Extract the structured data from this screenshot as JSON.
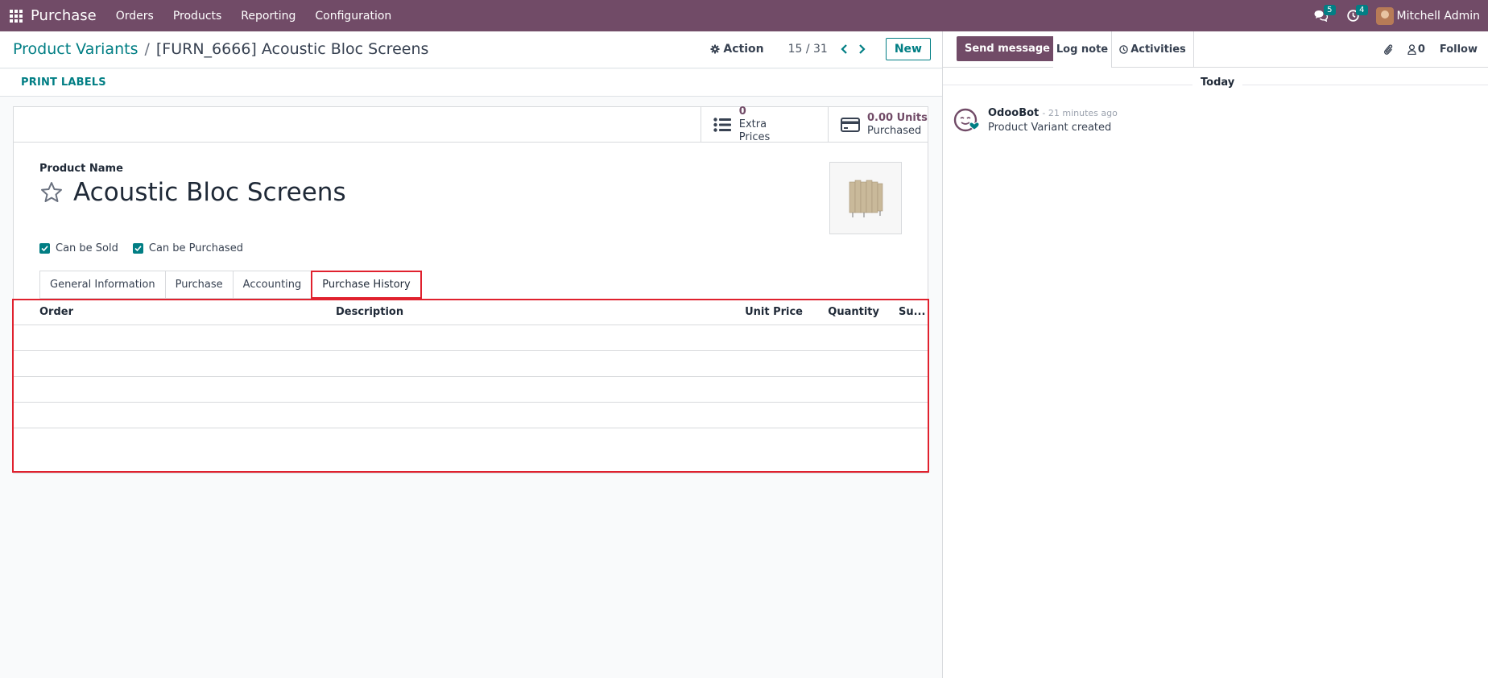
{
  "navbar": {
    "app_name": "Purchase",
    "menu": [
      "Orders",
      "Products",
      "Reporting",
      "Configuration"
    ],
    "messages_badge": "5",
    "activities_badge": "4",
    "user_name": "Mitchell Admin"
  },
  "control_panel": {
    "breadcrumb_parent": "Product Variants",
    "breadcrumb_separator": "/",
    "breadcrumb_current": "[FURN_6666] Acoustic Bloc Screens",
    "action_label": "Action",
    "pager": "15 / 31",
    "new_label": "New"
  },
  "statusbar": {
    "print_labels": "PRINT LABELS"
  },
  "stat_buttons": {
    "extra_prices_value": "0",
    "extra_prices_label": "Extra Prices",
    "purchased_value": "0.00 Units",
    "purchased_label": "Purchased"
  },
  "form": {
    "product_name_label": "Product Name",
    "product_name": "Acoustic Bloc Screens",
    "can_be_sold_label": "Can be Sold",
    "can_be_purchased_label": "Can be Purchased",
    "can_be_sold": true,
    "can_be_purchased": true
  },
  "tabs": [
    "General Information",
    "Purchase",
    "Accounting",
    "Purchase History"
  ],
  "active_tab": "Purchase History",
  "history_table": {
    "columns": [
      "Order",
      "Description",
      "Unit Price",
      "Quantity",
      "Su..."
    ],
    "rows": []
  },
  "chatter": {
    "send_message": "Send message",
    "log_note": "Log note",
    "activities": "Activities",
    "followers_count": "0",
    "follow": "Follow",
    "day_label": "Today",
    "message_author": "OdooBot",
    "message_time": "- 21 minutes ago",
    "message_body": "Product Variant created"
  },
  "colors": {
    "brand": "#714b67",
    "accent": "#017e84",
    "highlight": "#e0212e"
  }
}
